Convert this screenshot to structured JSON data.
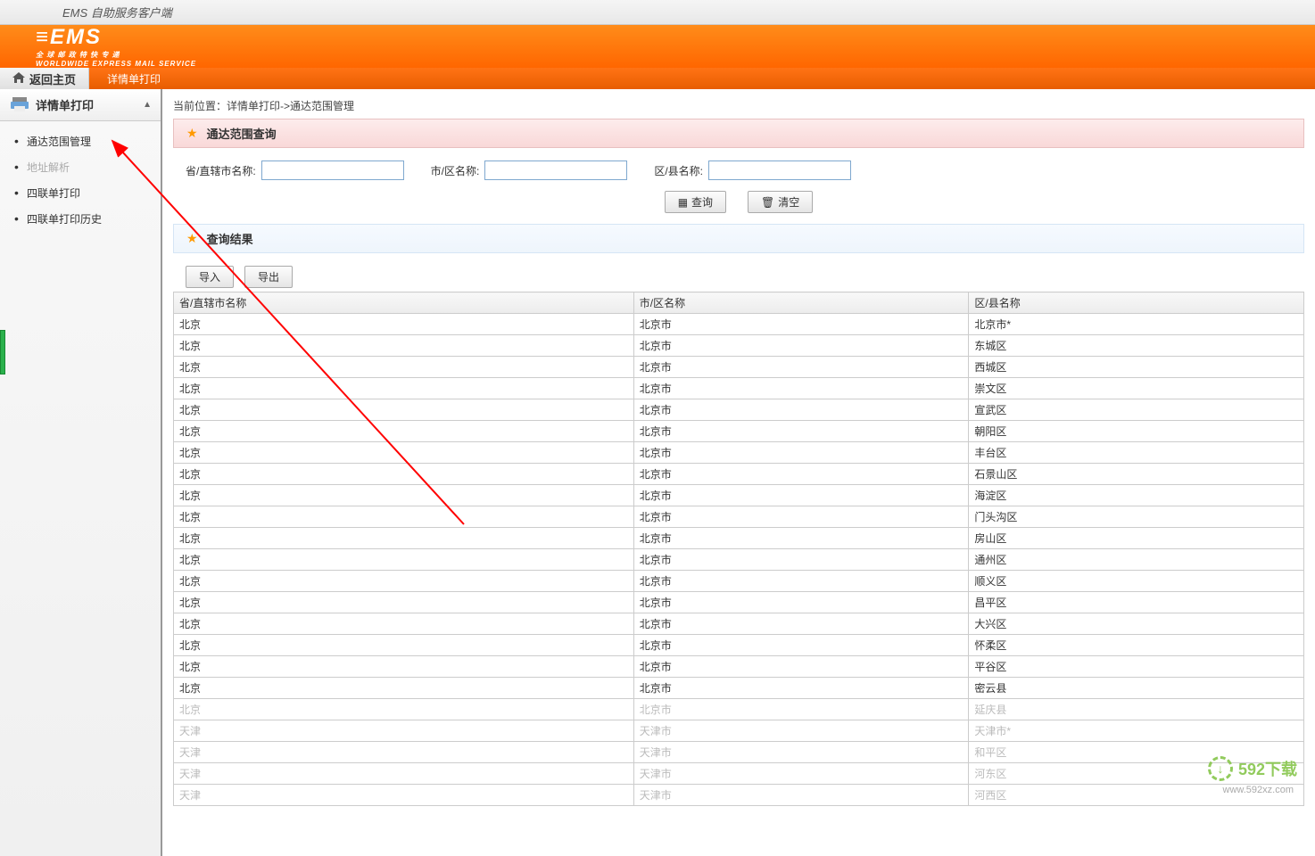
{
  "app_title": "EMS 自助服务客户端",
  "logo": {
    "main": "≡EMS",
    "sub_cn": "全 球 邮 政 特 快 专 递",
    "sub_en": "WORLDWIDE EXPRESS MAIL SERVICE"
  },
  "nav": {
    "home": "返回主页",
    "active_tab": "详情单打印"
  },
  "sidebar": {
    "header": "详情单打印",
    "items": [
      {
        "label": "通达范围管理",
        "disabled": false
      },
      {
        "label": "地址解析",
        "disabled": true
      },
      {
        "label": "四联单打印",
        "disabled": false
      },
      {
        "label": "四联单打印历史",
        "disabled": false
      }
    ]
  },
  "breadcrumb": "当前位置：详情单打印->通达范围管理",
  "section_query": "通达范围查询",
  "section_result": "查询结果",
  "search": {
    "province_label": "省/直辖市名称:",
    "city_label": "市/区名称:",
    "county_label": "区/县名称:",
    "province_value": "",
    "city_value": "",
    "county_value": ""
  },
  "buttons": {
    "query": "查询",
    "clear": "清空",
    "import": "导入",
    "export": "导出"
  },
  "table": {
    "headers": [
      "省/直辖市名称",
      "市/区名称",
      "区/县名称"
    ],
    "rows": [
      {
        "p": "北京",
        "c": "北京市",
        "d": "北京市*",
        "dim": false
      },
      {
        "p": "北京",
        "c": "北京市",
        "d": "东城区",
        "dim": false
      },
      {
        "p": "北京",
        "c": "北京市",
        "d": "西城区",
        "dim": false
      },
      {
        "p": "北京",
        "c": "北京市",
        "d": "崇文区",
        "dim": false
      },
      {
        "p": "北京",
        "c": "北京市",
        "d": "宣武区",
        "dim": false
      },
      {
        "p": "北京",
        "c": "北京市",
        "d": "朝阳区",
        "dim": false
      },
      {
        "p": "北京",
        "c": "北京市",
        "d": "丰台区",
        "dim": false
      },
      {
        "p": "北京",
        "c": "北京市",
        "d": "石景山区",
        "dim": false
      },
      {
        "p": "北京",
        "c": "北京市",
        "d": "海淀区",
        "dim": false
      },
      {
        "p": "北京",
        "c": "北京市",
        "d": "门头沟区",
        "dim": false
      },
      {
        "p": "北京",
        "c": "北京市",
        "d": "房山区",
        "dim": false
      },
      {
        "p": "北京",
        "c": "北京市",
        "d": "通州区",
        "dim": false
      },
      {
        "p": "北京",
        "c": "北京市",
        "d": "顺义区",
        "dim": false
      },
      {
        "p": "北京",
        "c": "北京市",
        "d": "昌平区",
        "dim": false
      },
      {
        "p": "北京",
        "c": "北京市",
        "d": "大兴区",
        "dim": false
      },
      {
        "p": "北京",
        "c": "北京市",
        "d": "怀柔区",
        "dim": false
      },
      {
        "p": "北京",
        "c": "北京市",
        "d": "平谷区",
        "dim": false
      },
      {
        "p": "北京",
        "c": "北京市",
        "d": "密云县",
        "dim": false
      },
      {
        "p": "北京",
        "c": "北京市",
        "d": "延庆县",
        "dim": true
      },
      {
        "p": "天津",
        "c": "天津市",
        "d": "天津市*",
        "dim": true
      },
      {
        "p": "天津",
        "c": "天津市",
        "d": "和平区",
        "dim": true
      },
      {
        "p": "天津",
        "c": "天津市",
        "d": "河东区",
        "dim": true
      },
      {
        "p": "天津",
        "c": "天津市",
        "d": "河西区",
        "dim": true
      }
    ]
  },
  "watermark": {
    "text": "592下载",
    "url": "www.592xz.com"
  }
}
